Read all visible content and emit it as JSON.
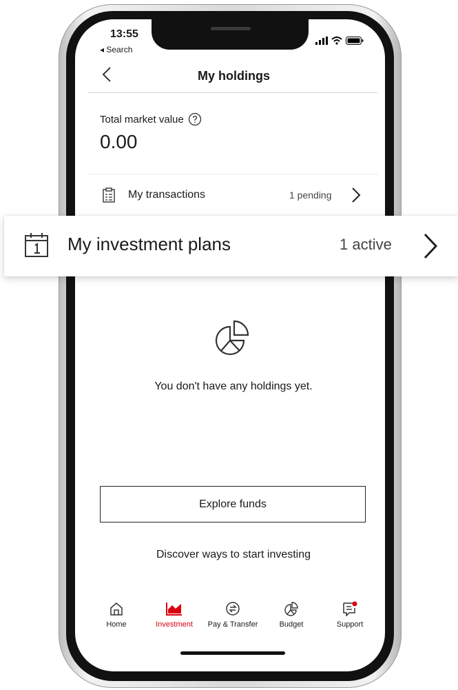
{
  "status_bar": {
    "time": "13:55",
    "back_app": "◂ Search"
  },
  "header": {
    "title": "My holdings"
  },
  "summary": {
    "label": "Total market value",
    "value": "0.00"
  },
  "transactions": {
    "label": "My transactions",
    "status": "1 pending"
  },
  "investment_plans": {
    "label": "My investment plans",
    "status": "1 active"
  },
  "empty_state": {
    "message": "You don't have any holdings yet."
  },
  "actions": {
    "explore_label": "Explore funds",
    "discover_label": "Discover ways to start investing"
  },
  "tabs": [
    {
      "label": "Home",
      "icon": "home-icon"
    },
    {
      "label": "Investment",
      "icon": "investment-chart-icon",
      "active": true
    },
    {
      "label": "Pay & Transfer",
      "icon": "transfer-icon"
    },
    {
      "label": "Budget",
      "icon": "pie-chart-icon"
    },
    {
      "label": "Support",
      "icon": "chat-icon"
    }
  ],
  "colors": {
    "accent": "#db0011",
    "text": "#1a1a1a",
    "divider": "#e6e6e6"
  }
}
